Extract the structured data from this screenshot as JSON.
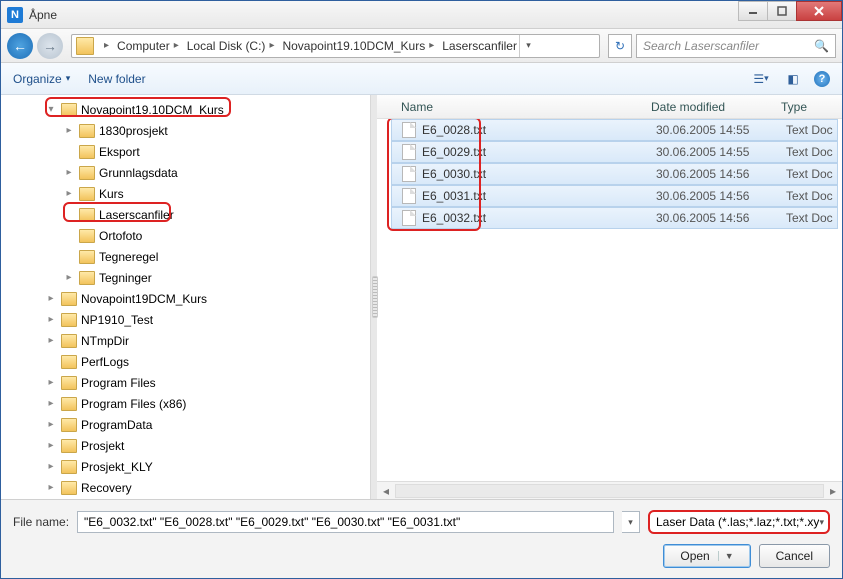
{
  "window": {
    "title": "Åpne",
    "app_icon_letter": "N"
  },
  "breadcrumbs": [
    "Computer",
    "Local Disk (C:)",
    "Novapoint19.10DCM_Kurs",
    "Laserscanfiler"
  ],
  "search": {
    "placeholder": "Search Laserscanfiler"
  },
  "toolbar": {
    "organize": "Organize",
    "newfolder": "New folder"
  },
  "tree": [
    {
      "name": "Novapoint19.10DCM_Kurs",
      "level": 0,
      "exp": "▾",
      "highlight": true
    },
    {
      "name": "1830prosjekt",
      "level": 1,
      "exp": "▸"
    },
    {
      "name": "Eksport",
      "level": 1,
      "exp": ""
    },
    {
      "name": "Grunnlagsdata",
      "level": 1,
      "exp": "▸"
    },
    {
      "name": "Kurs",
      "level": 1,
      "exp": "▸"
    },
    {
      "name": "Laserscanfiler",
      "level": 1,
      "exp": "",
      "highlight": true
    },
    {
      "name": "Ortofoto",
      "level": 1,
      "exp": ""
    },
    {
      "name": "Tegneregel",
      "level": 1,
      "exp": ""
    },
    {
      "name": "Tegninger",
      "level": 1,
      "exp": "▸"
    },
    {
      "name": "Novapoint19DCM_Kurs",
      "level": 0,
      "exp": "▸"
    },
    {
      "name": "NP1910_Test",
      "level": 0,
      "exp": "▸"
    },
    {
      "name": "NTmpDir",
      "level": 0,
      "exp": "▸"
    },
    {
      "name": "PerfLogs",
      "level": 0,
      "exp": ""
    },
    {
      "name": "Program Files",
      "level": 0,
      "exp": "▸"
    },
    {
      "name": "Program Files (x86)",
      "level": 0,
      "exp": "▸"
    },
    {
      "name": "ProgramData",
      "level": 0,
      "exp": "▸"
    },
    {
      "name": "Prosjekt",
      "level": 0,
      "exp": "▸"
    },
    {
      "name": "Prosjekt_KLY",
      "level": 0,
      "exp": "▸"
    },
    {
      "name": "Recovery",
      "level": 0,
      "exp": "▸"
    }
  ],
  "columns": {
    "name": "Name",
    "date": "Date modified",
    "type": "Type"
  },
  "files": [
    {
      "name": "E6_0028.txt",
      "date": "30.06.2005 14:55",
      "type": "Text Doc"
    },
    {
      "name": "E6_0029.txt",
      "date": "30.06.2005 14:55",
      "type": "Text Doc"
    },
    {
      "name": "E6_0030.txt",
      "date": "30.06.2005 14:56",
      "type": "Text Doc"
    },
    {
      "name": "E6_0031.txt",
      "date": "30.06.2005 14:56",
      "type": "Text Doc"
    },
    {
      "name": "E6_0032.txt",
      "date": "30.06.2005 14:56",
      "type": "Text Doc"
    }
  ],
  "footer": {
    "filename_label": "File name:",
    "filename_value": "\"E6_0032.txt\" \"E6_0028.txt\" \"E6_0029.txt\" \"E6_0030.txt\" \"E6_0031.txt\"",
    "filter": "Laser Data (*.las;*.laz;*.txt;*.xyz)",
    "open": "Open",
    "cancel": "Cancel"
  }
}
